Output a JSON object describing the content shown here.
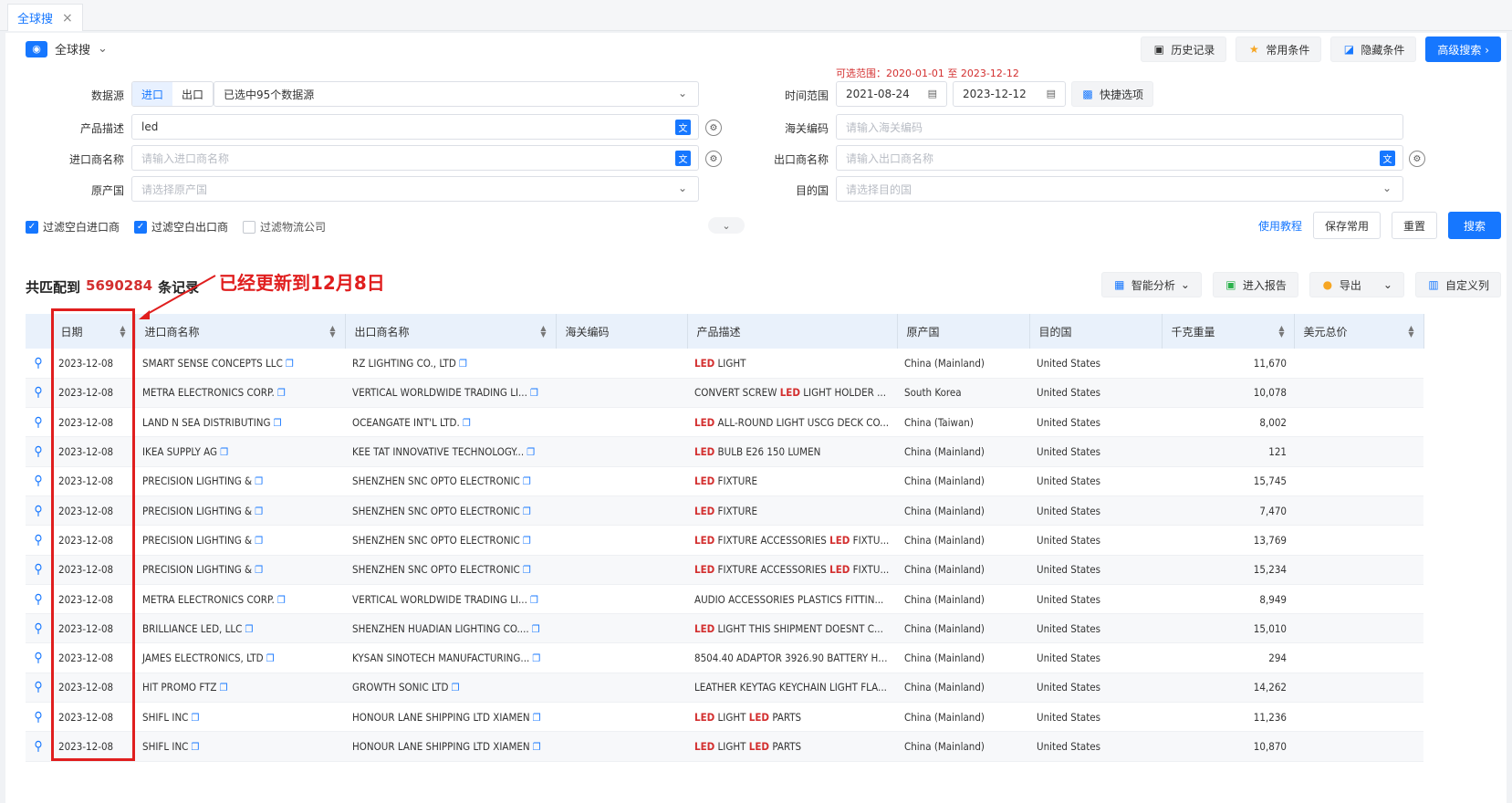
{
  "tab": {
    "label": "全球搜",
    "close": "×"
  },
  "scope": {
    "label": "全球搜"
  },
  "top_buttons": {
    "history": "历史记录",
    "common": "常用条件",
    "hide": "隐藏条件",
    "advanced": "高级搜索 ›"
  },
  "form": {
    "datasource_label": "数据源",
    "import_label": "进口",
    "export_label": "出口",
    "datasource_value": "已选中95个数据源",
    "time_label": "时间范围",
    "range_note": "可选范围：2020-01-01 至 2023-12-12",
    "date_from": "2021-08-24",
    "date_to": "2023-12-12",
    "quick_label": "快捷选项",
    "product_label": "产品描述",
    "product_value": "led",
    "hs_label": "海关编码",
    "hs_placeholder": "请输入海关编码",
    "importer_label": "进口商名称",
    "importer_placeholder": "请输入进口商名称",
    "exporter_label": "出口商名称",
    "exporter_placeholder": "请输入出口商名称",
    "origin_label": "原产国",
    "origin_placeholder": "请选择原产国",
    "dest_label": "目的国",
    "dest_placeholder": "请选择目的国"
  },
  "filters": {
    "f1": "过滤空白进口商",
    "f2": "过滤空白出口商",
    "f3": "过滤物流公司"
  },
  "actions": {
    "tutorial": "使用教程",
    "save": "保存常用",
    "reset": "重置",
    "search": "搜索"
  },
  "results": {
    "prefix": "共匹配到",
    "count": "5690284",
    "suffix": "条记录",
    "annotation": "已经更新到12月8日",
    "smart": "智能分析",
    "report": "进入报告",
    "export": "导出",
    "custom": "自定义列"
  },
  "columns": [
    "日期",
    "进口商名称",
    "出口商名称",
    "海关编码",
    "产品描述",
    "原产国",
    "目的国",
    "千克重量",
    "美元总价"
  ],
  "rows": [
    {
      "date": "2023-12-08",
      "importer": "SMART SENSE CONCEPTS LLC",
      "exporter": "RZ LIGHTING CO., LTD",
      "hs": "",
      "desc_hl": "LED",
      "desc": " LIGHT",
      "origin": "China (Mainland)",
      "dest": "United States",
      "kg": "11,670",
      "usd": ""
    },
    {
      "date": "2023-12-08",
      "importer": "METRA ELECTRONICS CORP.",
      "exporter": "VERTICAL WORLDWIDE TRADING LI...",
      "hs": "",
      "desc_pre": "CONVERT SCREW ",
      "desc_hl": "LED",
      "desc": " LIGHT HOLDER ...",
      "origin": "South Korea",
      "dest": "United States",
      "kg": "10,078",
      "usd": ""
    },
    {
      "date": "2023-12-08",
      "importer": "LAND N SEA DISTRIBUTING",
      "exporter": "OCEANGATE INT'L LTD.",
      "hs": "",
      "desc_hl": "LED",
      "desc": " ALL-ROUND LIGHT USCG DECK CO...",
      "origin": "China (Taiwan)",
      "dest": "United States",
      "kg": "8,002",
      "usd": ""
    },
    {
      "date": "2023-12-08",
      "importer": "IKEA SUPPLY AG",
      "exporter": "KEE TAT INNOVATIVE TECHNOLOGY...",
      "hs": "",
      "desc_hl": "LED",
      "desc": " BULB E26 150 LUMEN",
      "origin": "China (Mainland)",
      "dest": "United States",
      "kg": "121",
      "usd": ""
    },
    {
      "date": "2023-12-08",
      "importer": "PRECISION LIGHTING &",
      "exporter": "SHENZHEN SNC OPTO ELECTRONIC",
      "hs": "",
      "desc_hl": "LED",
      "desc": " FIXTURE",
      "origin": "China (Mainland)",
      "dest": "United States",
      "kg": "15,745",
      "usd": ""
    },
    {
      "date": "2023-12-08",
      "importer": "PRECISION LIGHTING &",
      "exporter": "SHENZHEN SNC OPTO ELECTRONIC",
      "hs": "",
      "desc_hl": "LED",
      "desc": " FIXTURE",
      "origin": "China (Mainland)",
      "dest": "United States",
      "kg": "7,470",
      "usd": ""
    },
    {
      "date": "2023-12-08",
      "importer": "PRECISION LIGHTING &",
      "exporter": "SHENZHEN SNC OPTO ELECTRONIC",
      "hs": "",
      "desc_hl": "LED",
      "desc": " FIXTURE ACCESSORIES ",
      "desc_hl2": "LED",
      "desc2": " FIXTU...",
      "origin": "China (Mainland)",
      "dest": "United States",
      "kg": "13,769",
      "usd": ""
    },
    {
      "date": "2023-12-08",
      "importer": "PRECISION LIGHTING &",
      "exporter": "SHENZHEN SNC OPTO ELECTRONIC",
      "hs": "",
      "desc_hl": "LED",
      "desc": " FIXTURE ACCESSORIES ",
      "desc_hl2": "LED",
      "desc2": " FIXTU...",
      "origin": "China (Mainland)",
      "dest": "United States",
      "kg": "15,234",
      "usd": ""
    },
    {
      "date": "2023-12-08",
      "importer": "METRA ELECTRONICS CORP.",
      "exporter": "VERTICAL WORLDWIDE TRADING LI...",
      "hs": "",
      "desc_pre": "AUDIO ACCESSORIES PLASTICS FITTIN...",
      "origin": "China (Mainland)",
      "dest": "United States",
      "kg": "8,949",
      "usd": ""
    },
    {
      "date": "2023-12-08",
      "importer": "BRILLIANCE LED, LLC",
      "exporter": "SHENZHEN HUADIAN LIGHTING CO....",
      "hs": "",
      "desc_hl": "LED",
      "desc": " LIGHT THIS SHIPMENT DOESNT C...",
      "origin": "China (Mainland)",
      "dest": "United States",
      "kg": "15,010",
      "usd": ""
    },
    {
      "date": "2023-12-08",
      "importer": "JAMES ELECTRONICS, LTD",
      "exporter": "KYSAN SINOTECH MANUFACTURING...",
      "hs": "",
      "desc_pre": "8504.40 ADAPTOR 3926.90 BATTERY HO...",
      "origin": "China (Mainland)",
      "dest": "United States",
      "kg": "294",
      "usd": ""
    },
    {
      "date": "2023-12-08",
      "importer": "HIT PROMO FTZ",
      "exporter": "GROWTH SONIC LTD",
      "hs": "",
      "desc_pre": "LEATHER KEYTAG KEYCHAIN LIGHT FLA...",
      "origin": "China (Mainland)",
      "dest": "United States",
      "kg": "14,262",
      "usd": ""
    },
    {
      "date": "2023-12-08",
      "importer": "SHIFL INC",
      "exporter": "HONOUR LANE SHIPPING LTD XIAMEN",
      "hs": "",
      "desc_hl": "LED",
      "desc": " LIGHT ",
      "desc_hl2": "LED",
      "desc2": " PARTS",
      "origin": "China (Mainland)",
      "dest": "United States",
      "kg": "11,236",
      "usd": ""
    },
    {
      "date": "2023-12-08",
      "importer": "SHIFL INC",
      "exporter": "HONOUR LANE SHIPPING LTD XIAMEN",
      "hs": "",
      "desc_hl": "LED",
      "desc": " LIGHT ",
      "desc_hl2": "LED",
      "desc2": " PARTS",
      "origin": "China (Mainland)",
      "dest": "United States",
      "kg": "10,870",
      "usd": ""
    }
  ]
}
